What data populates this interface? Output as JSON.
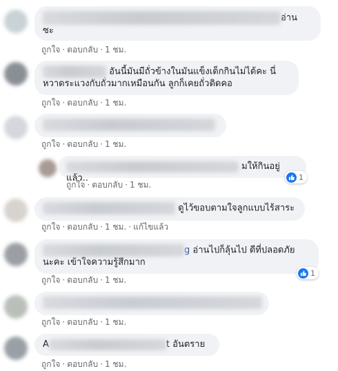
{
  "comments": [
    {
      "text": "อ่าน\nซะ",
      "actions": {
        "like": "ถูกใจ",
        "reply": "ตอบกลับ",
        "time": "1 ชม."
      }
    },
    {
      "text": "อันนี้มันมีถั่วข้างในมันแข็งเด็กกินไม่ได้คะ นี่\nหวาดระแวงกับถั่วมากเหมือนกัน ลูกก็เคยถั่วติดคอ",
      "actions": {
        "like": "ถูกใจ",
        "reply": "ตอบกลับ",
        "time": "1 ชม."
      }
    },
    {
      "text": "",
      "actions": {
        "like": "ถูกใจ",
        "reply": "ตอบกลับ",
        "time": "1 ชม."
      }
    },
    {
      "text": "มให้กินอยู่แล้ว..",
      "actions": {
        "like": "ถูกใจ",
        "reply": "ตอบกลับ",
        "time": "1 ชม."
      },
      "reaction_count": "1"
    },
    {
      "text": "ดูไว้ขอบตามใจลูกแบบไร้สาระ",
      "actions": {
        "like": "ถูกใจ",
        "reply": "ตอบกลับ",
        "time": "1 ชม.",
        "edited": "แก้ไขแล้ว"
      }
    },
    {
      "text_end_of_name": "g",
      "text": "อ่านไปก็ลุ้นไป ดีที่ปลอดภัย\nนะคะ เข้าใจความรู้สึกมาก",
      "actions": {
        "like": "ถูกใจ",
        "reply": "ตอบกลับ",
        "time": "1 ชม."
      },
      "reaction_count": "1"
    },
    {
      "text": "",
      "actions": {
        "like": "ถูกใจ",
        "reply": "ตอบกลับ",
        "time": "1 ชม."
      }
    },
    {
      "text_start_of_name": "A",
      "text_end_of_name": "t",
      "text": "อันตราย",
      "actions": {
        "like": "ถูกใจ",
        "reply": "ตอบกลับ",
        "time": "1 ชม."
      }
    }
  ],
  "colors": {
    "bubble": "#f0f2f5",
    "action_text": "#65676b",
    "like_blue": "#1877f2"
  }
}
